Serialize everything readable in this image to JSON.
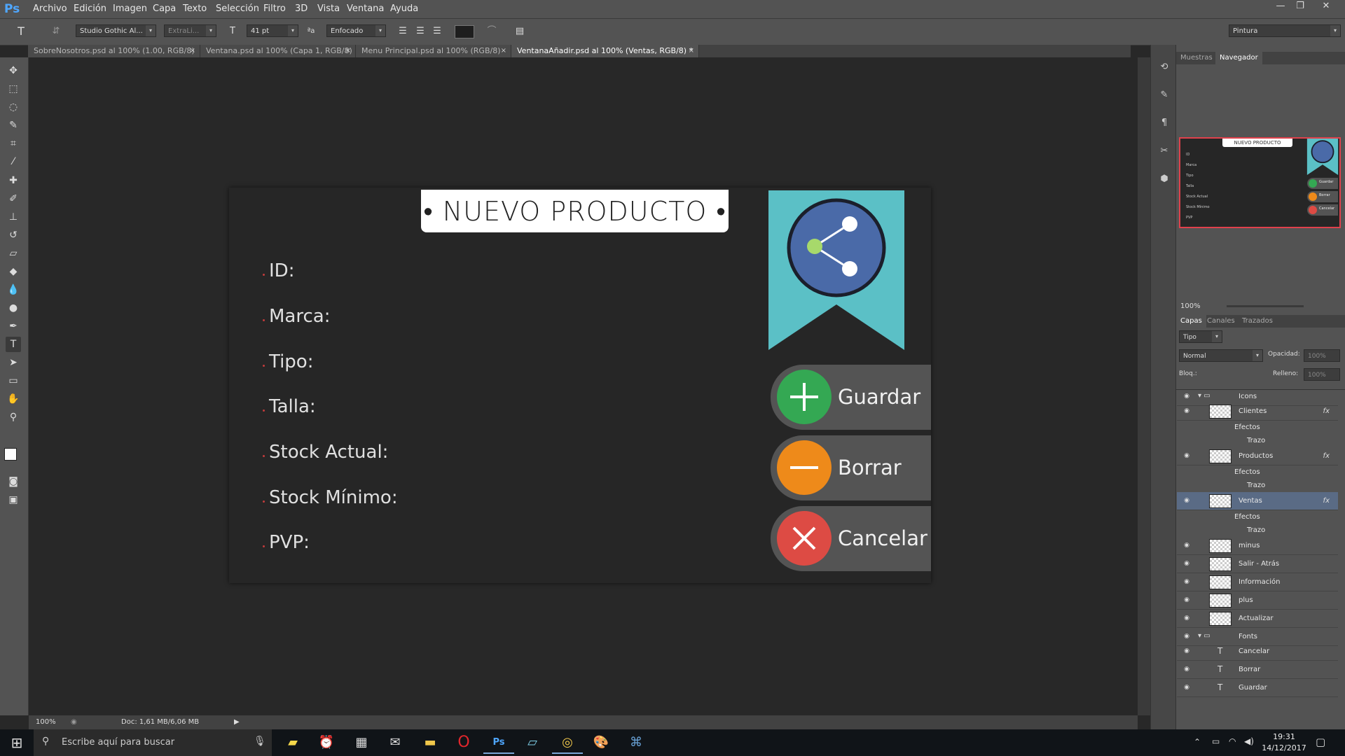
{
  "app": {
    "logo": "Ps"
  },
  "menu": [
    "Archivo",
    "Edición",
    "Imagen",
    "Capa",
    "Texto",
    "Selección",
    "Filtro",
    "3D",
    "Vista",
    "Ventana",
    "Ayuda"
  ],
  "window_controls": [
    "—",
    "❐",
    "✕"
  ],
  "options_bar": {
    "font_family": "Studio Gothic Al...",
    "font_style": "ExtraLi...",
    "font_size": "41 pt",
    "antialias_label": "ªa",
    "antialias": "Enfocado",
    "workspace": "Pintura"
  },
  "tabs": [
    {
      "label": "SobreNosotros.psd al 100% (1.00, RGB/8)",
      "close": "×"
    },
    {
      "label": "Ventana.psd al 100% (Capa 1, RGB/8)",
      "close": "×"
    },
    {
      "label": "Menu Principal.psd al 100% (RGB/8)",
      "close": "×"
    },
    {
      "label": "VentanaAñadir.psd al 100% (Ventas, RGB/8) *",
      "close": "×"
    }
  ],
  "document": {
    "title": "•  NUEVO PRODUCTO  •",
    "fields": [
      "ID:",
      "Marca:",
      "Tipo:",
      "Talla:",
      "Stock Actual:",
      "Stock Mínimo:",
      "PVP:"
    ],
    "buttons": [
      {
        "label": "Guardar",
        "color": "#34a853",
        "symbol": "+"
      },
      {
        "label": "Borrar",
        "color": "#ee8a1a",
        "symbol": "—"
      },
      {
        "label": "Cancelar",
        "color": "#dd4b44",
        "symbol": "✕"
      }
    ],
    "ribbon_color": "#5bc0c6",
    "share_circle_color": "#4a6aa8"
  },
  "status": {
    "zoom": "100%",
    "doc": "Doc: 1,61 MB/6,06 MB"
  },
  "navigator": {
    "tabs": [
      "Muestras",
      "Navegador"
    ],
    "zoom": "100%",
    "thumb_title": "NUEVO PRODUCTO",
    "thumb_fields": [
      "ID",
      "Marca",
      "Tipo",
      "Talla",
      "Stock Actual",
      "Stock Mínimo",
      "PVP"
    ],
    "thumb_buttons": [
      "Guardar",
      "Borrar",
      "Cancelar"
    ]
  },
  "layers_panel": {
    "tabs": [
      "Capas",
      "Canales",
      "Trazados"
    ],
    "filter": "Tipo",
    "blend_mode": "Normal",
    "opacity_label": "Opacidad:",
    "opacity": "100%",
    "lock_label": "Bloq.:",
    "fill_label": "Relleno:",
    "fill": "100%",
    "layers": [
      {
        "name": "Icons",
        "type": "group"
      },
      {
        "name": "Clientes",
        "type": "layer",
        "fx": "fx"
      },
      {
        "name": "Efectos",
        "type": "sub"
      },
      {
        "name": "Trazo",
        "type": "sub2"
      },
      {
        "name": "Productos",
        "type": "layer",
        "fx": "fx"
      },
      {
        "name": "Efectos",
        "type": "sub"
      },
      {
        "name": "Trazo",
        "type": "sub2"
      },
      {
        "name": "Ventas",
        "type": "layer",
        "fx": "fx",
        "selected": true
      },
      {
        "name": "Efectos",
        "type": "sub"
      },
      {
        "name": "Trazo",
        "type": "sub2"
      },
      {
        "name": "minus",
        "type": "layer"
      },
      {
        "name": "Salir - Atrás",
        "type": "layer"
      },
      {
        "name": "Información",
        "type": "layer"
      },
      {
        "name": "plus",
        "type": "layer"
      },
      {
        "name": "Actualizar",
        "type": "layer"
      },
      {
        "name": "Fonts",
        "type": "group"
      },
      {
        "name": "Cancelar",
        "type": "text"
      },
      {
        "name": "Borrar",
        "type": "text"
      },
      {
        "name": "Guardar",
        "type": "text"
      }
    ]
  },
  "taskbar": {
    "search_placeholder": "Escribe aquí para buscar",
    "time": "19:31",
    "date": "14/12/2017"
  }
}
